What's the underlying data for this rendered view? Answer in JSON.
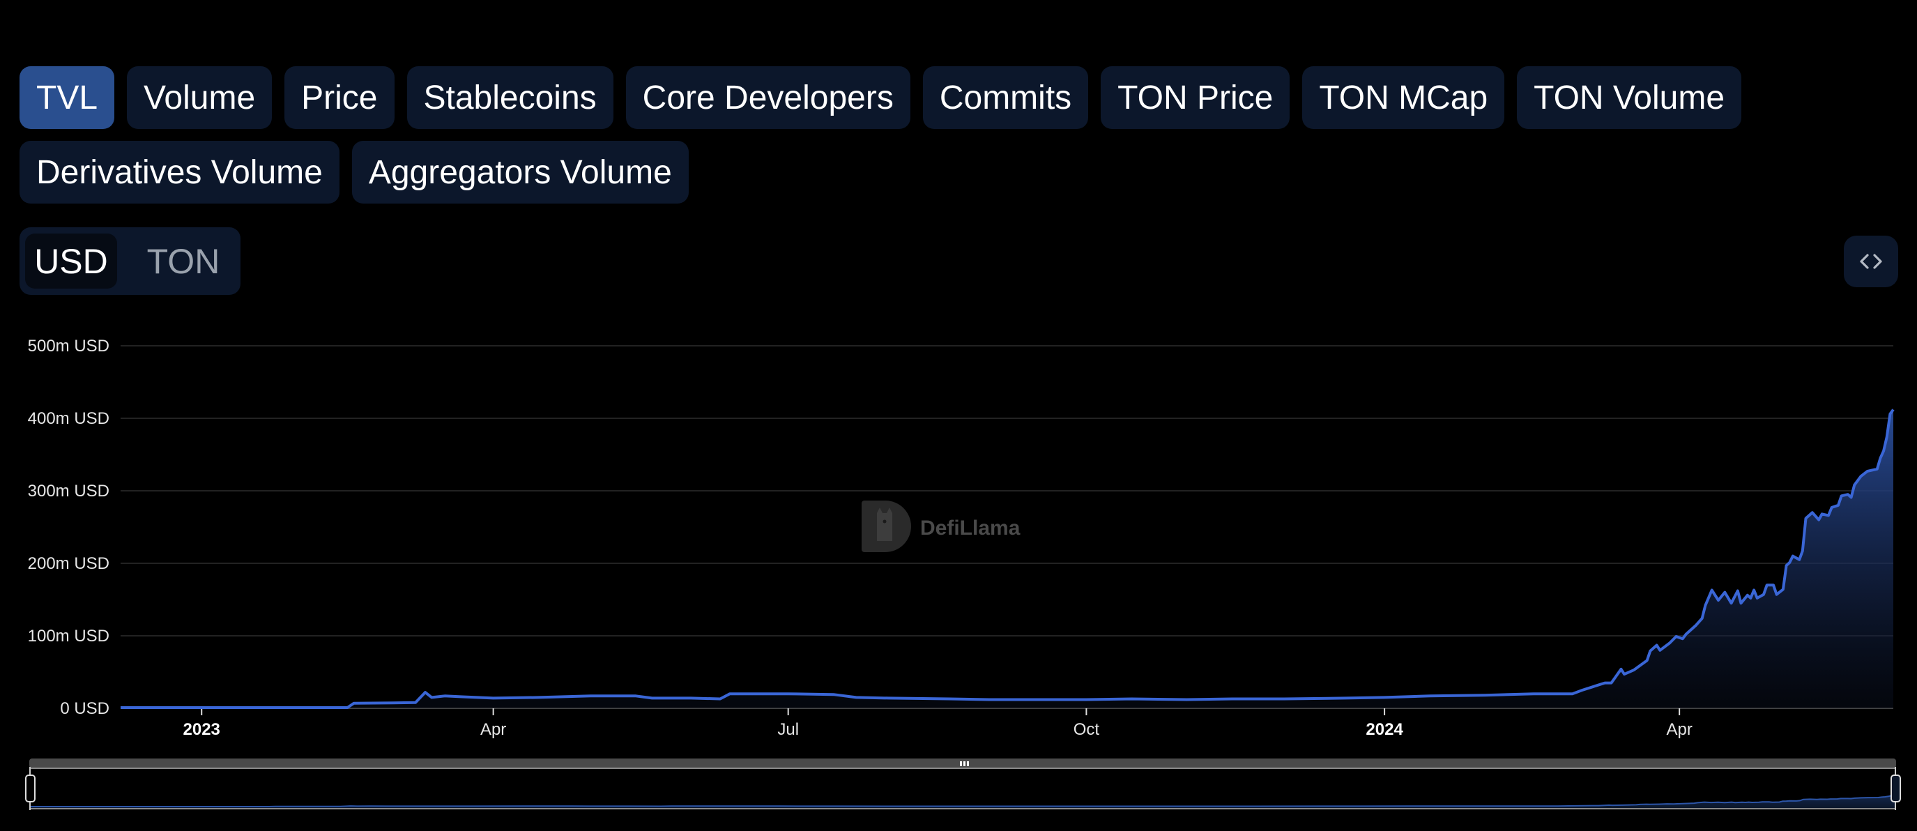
{
  "tabs": [
    {
      "label": "TVL",
      "active": true
    },
    {
      "label": "Volume",
      "active": false
    },
    {
      "label": "Price",
      "active": false
    },
    {
      "label": "Stablecoins",
      "active": false
    },
    {
      "label": "Core Developers",
      "active": false
    },
    {
      "label": "Commits",
      "active": false
    },
    {
      "label": "TON Price",
      "active": false
    },
    {
      "label": "TON MCap",
      "active": false
    },
    {
      "label": "TON Volume",
      "active": false
    },
    {
      "label": "Derivatives Volume",
      "active": false
    },
    {
      "label": "Aggregators Volume",
      "active": false
    }
  ],
  "denomination": {
    "options": [
      "USD",
      "TON"
    ],
    "selected": "USD"
  },
  "embed_button": {
    "icon": "code-brackets-icon"
  },
  "watermark": {
    "text": "DefiLlama",
    "icon": "defillama-logo-icon"
  },
  "colors": {
    "accent": "#3a66d6",
    "tab_bg": "#0c172b",
    "tab_active_bg": "#2a4f8f"
  },
  "chart_data": {
    "type": "area",
    "title": "",
    "xlabel": "",
    "ylabel": "",
    "unit": "m USD",
    "ylim": [
      0,
      500
    ],
    "yticks": [
      0,
      100,
      200,
      300,
      400,
      500
    ],
    "ytick_labels": [
      "0 USD",
      "100m USD",
      "200m USD",
      "300m USD",
      "400m USD",
      "500m USD"
    ],
    "xlim": [
      "2022-12-07",
      "2024-06-06"
    ],
    "xticks": [
      {
        "date": "2023-01-01",
        "label": "2023",
        "bold": true
      },
      {
        "date": "2023-04-01",
        "label": "Apr",
        "bold": false
      },
      {
        "date": "2023-07-01",
        "label": "Jul",
        "bold": false
      },
      {
        "date": "2023-10-01",
        "label": "Oct",
        "bold": false
      },
      {
        "date": "2024-01-01",
        "label": "2024",
        "bold": true
      },
      {
        "date": "2024-04-01",
        "label": "Apr",
        "bold": false
      }
    ],
    "grid": true,
    "legend": "none",
    "series": [
      {
        "name": "TVL",
        "points": [
          [
            "2022-12-07",
            1
          ],
          [
            "2023-01-01",
            1
          ],
          [
            "2023-02-01",
            1
          ],
          [
            "2023-02-15",
            1
          ],
          [
            "2023-02-17",
            7
          ],
          [
            "2023-03-01",
            7.5
          ],
          [
            "2023-03-08",
            8
          ],
          [
            "2023-03-11",
            22
          ],
          [
            "2023-03-13",
            15
          ],
          [
            "2023-03-17",
            17
          ],
          [
            "2023-03-22",
            16
          ],
          [
            "2023-04-01",
            14
          ],
          [
            "2023-04-15",
            15
          ],
          [
            "2023-05-01",
            17
          ],
          [
            "2023-05-15",
            17
          ],
          [
            "2023-05-20",
            14
          ],
          [
            "2023-06-01",
            14
          ],
          [
            "2023-06-10",
            13
          ],
          [
            "2023-06-13",
            20
          ],
          [
            "2023-07-01",
            20
          ],
          [
            "2023-07-15",
            19
          ],
          [
            "2023-07-22",
            15
          ],
          [
            "2023-08-01",
            14
          ],
          [
            "2023-08-20",
            13
          ],
          [
            "2023-09-01",
            12
          ],
          [
            "2023-09-15",
            12
          ],
          [
            "2023-10-01",
            12
          ],
          [
            "2023-10-15",
            13
          ],
          [
            "2023-11-01",
            12
          ],
          [
            "2023-11-15",
            13
          ],
          [
            "2023-12-01",
            13
          ],
          [
            "2023-12-20",
            14
          ],
          [
            "2024-01-01",
            15
          ],
          [
            "2024-01-15",
            17
          ],
          [
            "2024-02-01",
            18
          ],
          [
            "2024-02-16",
            20
          ],
          [
            "2024-02-28",
            20
          ],
          [
            "2024-03-02",
            25
          ],
          [
            "2024-03-09",
            35
          ],
          [
            "2024-03-11",
            35
          ],
          [
            "2024-03-14",
            54
          ],
          [
            "2024-03-15",
            47
          ],
          [
            "2024-03-18",
            53
          ],
          [
            "2024-03-22",
            66
          ],
          [
            "2024-03-23",
            79
          ],
          [
            "2024-03-25",
            87
          ],
          [
            "2024-03-26",
            80
          ],
          [
            "2024-03-29",
            90
          ],
          [
            "2024-03-31",
            99
          ],
          [
            "2024-04-02",
            96
          ],
          [
            "2024-04-03",
            102
          ],
          [
            "2024-04-06",
            114
          ],
          [
            "2024-04-08",
            124
          ],
          [
            "2024-04-09",
            142
          ],
          [
            "2024-04-11",
            163
          ],
          [
            "2024-04-13",
            149
          ],
          [
            "2024-04-15",
            160
          ],
          [
            "2024-04-17",
            145
          ],
          [
            "2024-04-19",
            162
          ],
          [
            "2024-04-20",
            145
          ],
          [
            "2024-04-22",
            156
          ],
          [
            "2024-04-23",
            152
          ],
          [
            "2024-04-24",
            163
          ],
          [
            "2024-04-25",
            152
          ],
          [
            "2024-04-27",
            157
          ],
          [
            "2024-04-28",
            170
          ],
          [
            "2024-04-30",
            170
          ],
          [
            "2024-05-01",
            157
          ],
          [
            "2024-05-03",
            164
          ],
          [
            "2024-05-04",
            197
          ],
          [
            "2024-05-05",
            201
          ],
          [
            "2024-05-06",
            210
          ],
          [
            "2024-05-08",
            205
          ],
          [
            "2024-05-09",
            217
          ],
          [
            "2024-05-10",
            262
          ],
          [
            "2024-05-12",
            270
          ],
          [
            "2024-05-14",
            260
          ],
          [
            "2024-05-15",
            268
          ],
          [
            "2024-05-17",
            266
          ],
          [
            "2024-05-18",
            277
          ],
          [
            "2024-05-20",
            280
          ],
          [
            "2024-05-21",
            293
          ],
          [
            "2024-05-23",
            295
          ],
          [
            "2024-05-24",
            291
          ],
          [
            "2024-05-25",
            308
          ],
          [
            "2024-05-27",
            320
          ],
          [
            "2024-05-29",
            327
          ],
          [
            "2024-06-01",
            330
          ],
          [
            "2024-06-02",
            345
          ],
          [
            "2024-06-03",
            355
          ],
          [
            "2024-06-04",
            374
          ],
          [
            "2024-06-05",
            406
          ],
          [
            "2024-06-06",
            412
          ]
        ]
      }
    ]
  },
  "data_zoom": {
    "range_start_pct": 0,
    "range_end_pct": 100
  }
}
